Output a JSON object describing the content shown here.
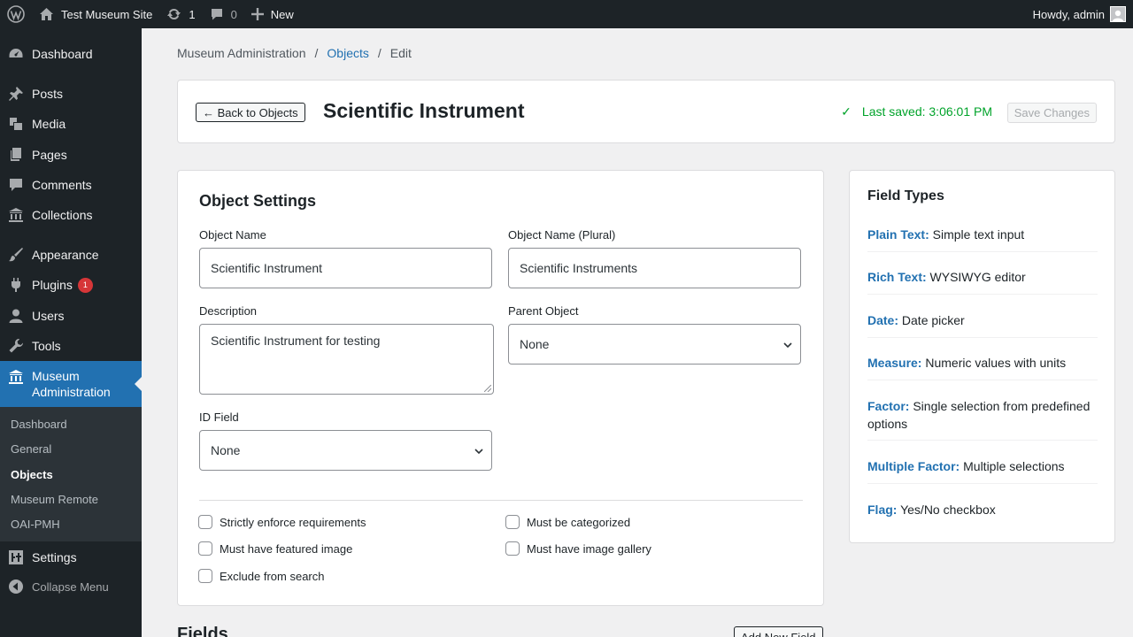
{
  "adminbar": {
    "site_name": "Test Museum Site",
    "updates_count": "1",
    "comments_count": "0",
    "new_label": "New",
    "greeting": "Howdy, admin"
  },
  "sidebar": {
    "items": [
      {
        "label": "Dashboard",
        "icon": "dashboard-icon"
      },
      {
        "label": "Posts",
        "icon": "pushpin-icon"
      },
      {
        "label": "Media",
        "icon": "media-icon"
      },
      {
        "label": "Pages",
        "icon": "pages-icon"
      },
      {
        "label": "Comments",
        "icon": "comment-icon"
      },
      {
        "label": "Collections",
        "icon": "building-icon"
      },
      {
        "label": "Appearance",
        "icon": "paintbrush-icon"
      },
      {
        "label": "Plugins",
        "icon": "plugin-icon",
        "badge": "1"
      },
      {
        "label": "Users",
        "icon": "user-icon"
      },
      {
        "label": "Tools",
        "icon": "wrench-icon"
      },
      {
        "label": "Museum Administration",
        "icon": "museum-icon"
      },
      {
        "label": "Settings",
        "icon": "settings-icon"
      },
      {
        "label": "Collapse Menu",
        "icon": "collapse-icon"
      }
    ],
    "submenu": [
      "Dashboard",
      "General",
      "Objects",
      "Museum Remote",
      "OAI-PMH"
    ],
    "submenu_active": "Objects"
  },
  "breadcrumb": {
    "root": "Museum Administration",
    "link": "Objects",
    "current": "Edit",
    "separator": "/"
  },
  "header": {
    "back_label": "← Back to Objects",
    "title": "Scientific Instrument",
    "check": "✓",
    "saved_text": "Last saved: 3:06:01 PM",
    "save_label": "Save Changes"
  },
  "settings": {
    "title": "Object Settings",
    "object_name_label": "Object Name",
    "object_name_value": "Scientific Instrument",
    "plural_label": "Object Name (Plural)",
    "plural_value": "Scientific Instruments",
    "description_label": "Description",
    "description_value": "Scientific Instrument for testing",
    "parent_label": "Parent Object",
    "parent_value": "None",
    "id_field_label": "ID Field",
    "id_field_value": "None",
    "checkboxes": [
      "Strictly enforce requirements",
      "Must be categorized",
      "Must have featured image",
      "Must have image gallery",
      "Exclude from search"
    ]
  },
  "field_types": {
    "title": "Field Types",
    "items": [
      {
        "key": "Plain Text:",
        "desc": "Simple text input"
      },
      {
        "key": "Rich Text:",
        "desc": "WYSIWYG editor"
      },
      {
        "key": "Date:",
        "desc": "Date picker"
      },
      {
        "key": "Measure:",
        "desc": "Numeric values with units"
      },
      {
        "key": "Factor:",
        "desc": "Single selection from predefined options"
      },
      {
        "key": "Multiple Factor:",
        "desc": "Multiple selections"
      },
      {
        "key": "Flag:",
        "desc": "Yes/No checkbox"
      }
    ]
  },
  "fields": {
    "title": "Fields",
    "add_label": "Add New Field"
  },
  "colors": {
    "accent": "#2271b1",
    "success": "#00a32a",
    "sidebar_bg": "#1d2327",
    "badge": "#d63638"
  }
}
